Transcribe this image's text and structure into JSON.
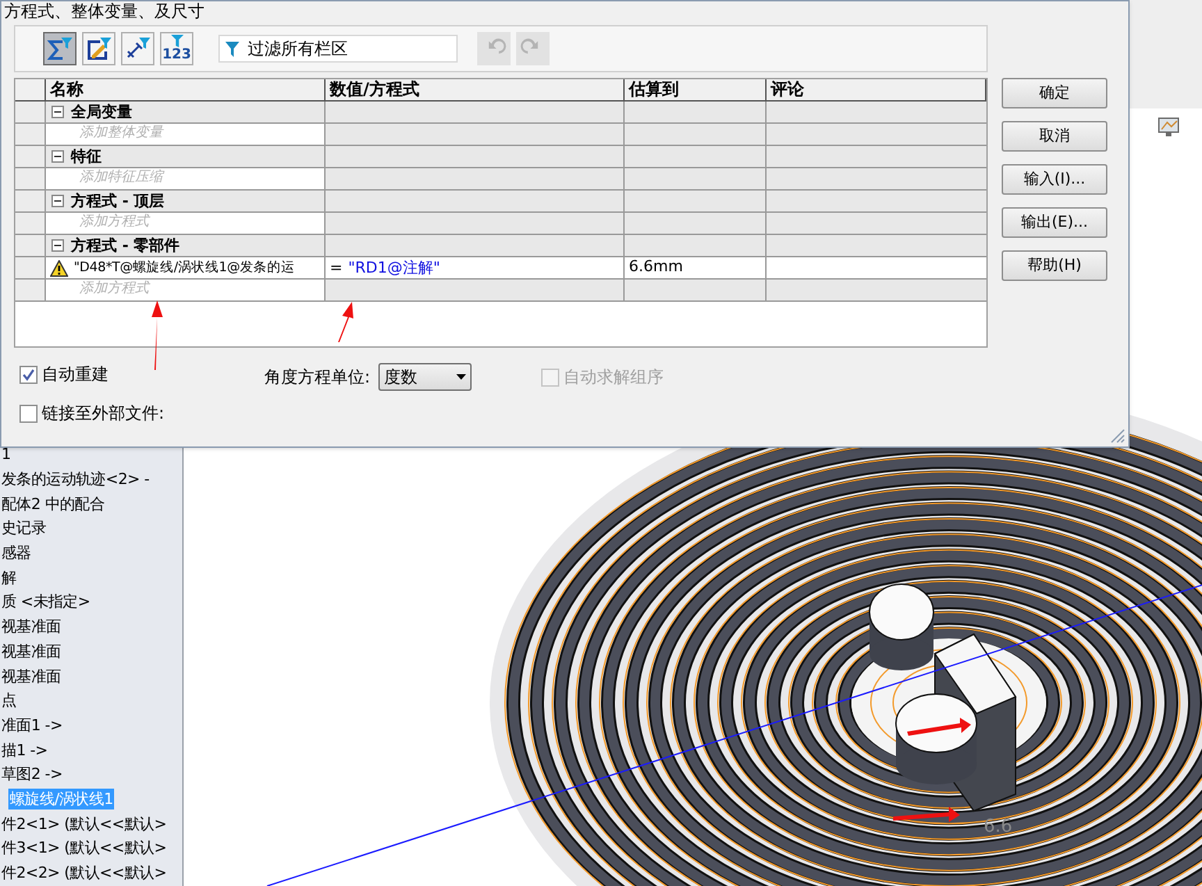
{
  "dialog": {
    "title": "方程式、整体变量、及尺寸",
    "toolbar": {
      "filters": [
        {
          "kind": "equations",
          "selected": true
        },
        {
          "kind": "sketch",
          "selected": false
        },
        {
          "kind": "dimension",
          "selected": false
        },
        {
          "kind": "values",
          "label": "123",
          "selected": false
        }
      ],
      "filter_field": {
        "placeholder": "过滤所有栏区"
      },
      "undo": {
        "disabled": true
      },
      "redo": {
        "disabled": true
      }
    },
    "table": {
      "columns": [
        "名称",
        "数值/方程式",
        "估算到",
        "评论"
      ],
      "rows": [
        {
          "kind": "group",
          "name": "全局变量",
          "expanded": true
        },
        {
          "kind": "hint",
          "name": "添加整体变量"
        },
        {
          "kind": "group",
          "name": "特征",
          "expanded": true
        },
        {
          "kind": "hint",
          "name": "添加特征压缩"
        },
        {
          "kind": "group",
          "name": "方程式 - 顶层",
          "expanded": true
        },
        {
          "kind": "hint",
          "name": "添加方程式"
        },
        {
          "kind": "group",
          "name": "方程式 - 零部件",
          "expanded": true
        },
        {
          "kind": "equation",
          "warning": true,
          "name": "\"D48*T@螺旋线/涡状线1@发条的运",
          "operator": "=",
          "value": "\"RD1@注解\"",
          "estimate": "6.6mm"
        },
        {
          "kind": "hint",
          "name": "添加方程式"
        }
      ]
    },
    "buttons": [
      "确定",
      "取消",
      "输入(I)...",
      "输出(E)...",
      "帮助(H)"
    ],
    "options": {
      "auto_rebuild": {
        "label": "自动重建",
        "checked": true
      },
      "link_external": {
        "label": "链接至外部文件:",
        "checked": false
      },
      "angle_unit": {
        "label": "角度方程单位:",
        "value": "度数"
      },
      "auto_solve_order": {
        "label": "自动求解组序",
        "checked": false,
        "disabled": true
      }
    }
  },
  "feature_tree": {
    "items": [
      {
        "label": "1",
        "selected": false
      },
      {
        "label": "发条的运动轨迹<2> -",
        "selected": false
      },
      {
        "label": "配体2 中的配合",
        "selected": false
      },
      {
        "label": "史记录",
        "selected": false
      },
      {
        "label": "感器",
        "selected": false
      },
      {
        "label": "解",
        "selected": false
      },
      {
        "label": "质 <未指定>",
        "selected": false
      },
      {
        "label": "视基准面",
        "selected": false
      },
      {
        "label": "视基准面",
        "selected": false
      },
      {
        "label": "视基准面",
        "selected": false
      },
      {
        "label": "点",
        "selected": false
      },
      {
        "label": "准面1 ->",
        "selected": false
      },
      {
        "label": "描1 ->",
        "selected": false
      },
      {
        "label": "草图2 ->",
        "selected": false
      },
      {
        "label": "螺旋线/涡状线1",
        "selected": true
      },
      {
        "label": "件2<1> (默认<<默认>",
        "selected": false
      },
      {
        "label": "件3<1> (默认<<默认>",
        "selected": false
      },
      {
        "label": "件2<2> (默认<<默认>",
        "selected": false
      }
    ]
  },
  "viewport": {
    "dimension_label": "6.6"
  }
}
